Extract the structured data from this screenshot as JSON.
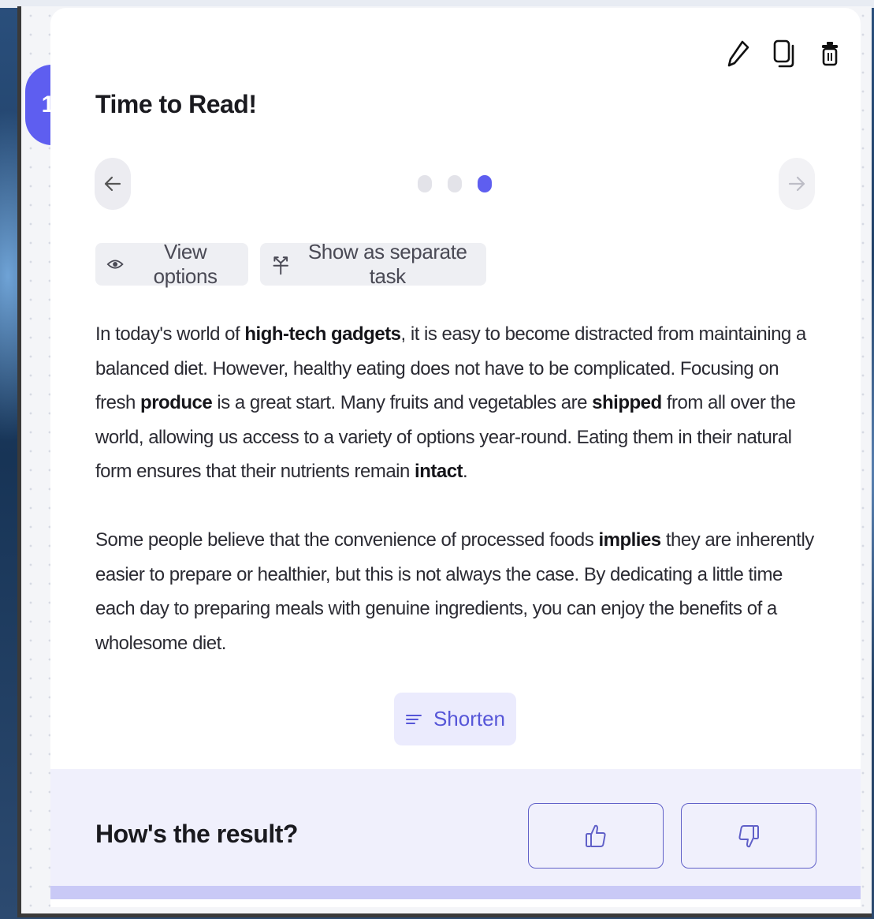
{
  "step": {
    "number": "1"
  },
  "card": {
    "title": "Time to Read!"
  },
  "carousel": {
    "pages": 3,
    "active_index": 2
  },
  "toolbar": {
    "view_options_label": "View options",
    "separate_task_label": "Show as separate task"
  },
  "passage": {
    "p1": {
      "s1": "In today's world of ",
      "b1": "high-tech gadgets",
      "s2": ", it is easy to become distracted from maintaining a balanced diet. However, healthy eating does not have to be complicated. Focusing on fresh ",
      "b2": "produce",
      "s3": " is a great start. Many fruits and vegetables are ",
      "b3": "shipped",
      "s4": " from all over the world, allowing us access to a variety of options year-round. Eating them in their natural form ensures that their nutrients remain ",
      "b4": "intact",
      "s5": "."
    },
    "p2": {
      "s1": "Some people believe that the convenience of processed foods ",
      "b1": "implies",
      "s2": " they are inherently easier to prepare or healthier, but this is not always the case. By dedicating a little time each day to preparing meals with genuine ingredients, you can enjoy the benefits of a wholesome diet."
    }
  },
  "actions": {
    "shorten_label": "Shorten"
  },
  "feedback": {
    "question": "How's the result?"
  },
  "colors": {
    "accent": "#5e5ef0",
    "feedback_bg": "#f0f0fc"
  }
}
